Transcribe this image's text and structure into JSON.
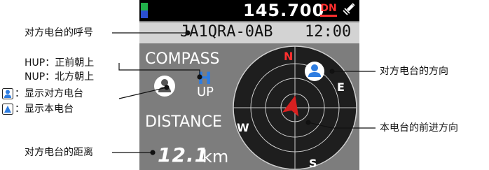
{
  "screen": {
    "frequency": "145.700",
    "dn_badge": "DN",
    "callsign": "JA1QRA-0AB",
    "time": "12:00",
    "compass_label": "COMPASS",
    "mode_letter": "H",
    "mode_sub": "UP",
    "distance_label": "DISTANCE",
    "distance_value": "12.1",
    "distance_unit": "km",
    "cardinal": {
      "n": "N",
      "e": "E",
      "s": "S",
      "w": "W"
    }
  },
  "callouts": {
    "partner_callsign": "对方电台的呼号",
    "hup": "HUP：正前朝上",
    "nup": "NUP：北方朝上",
    "show_partner": "：显示对方电台",
    "show_self": "：显示本电台",
    "partner_distance": "对方电台的距离",
    "partner_direction": "对方电台的方向",
    "own_heading": "本电台的前进方向"
  },
  "colors": {
    "screen_bg": "#7d7d7d",
    "accent_blue": "#2e7de1",
    "north_red": "#ff2f2f",
    "arrow_red": "#d92020"
  }
}
